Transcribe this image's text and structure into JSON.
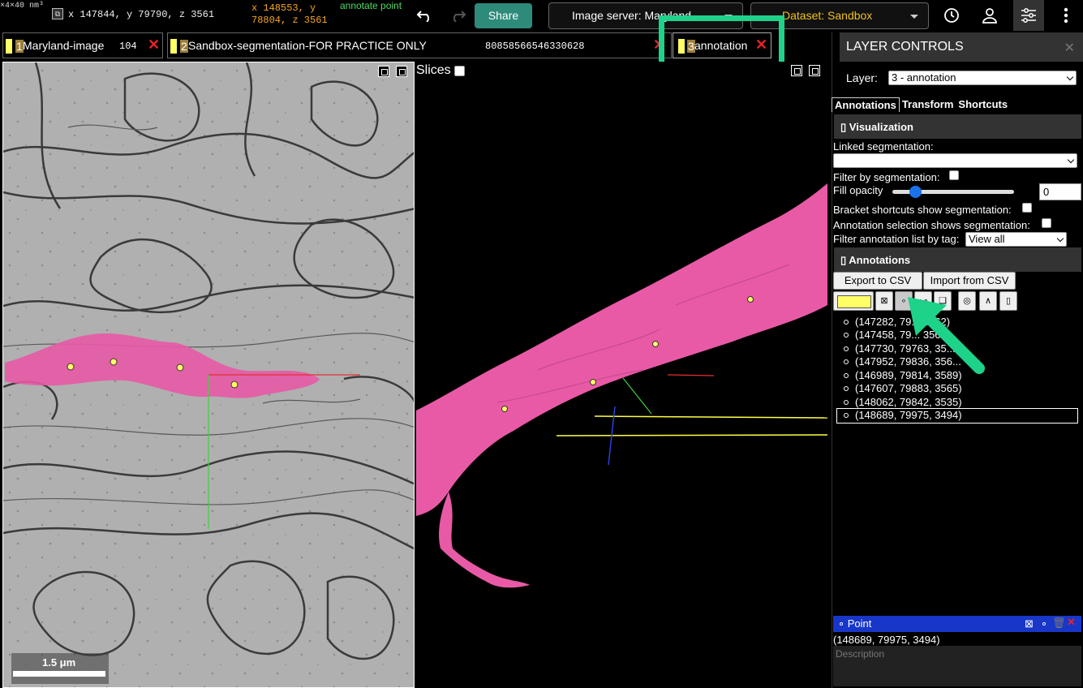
{
  "topbar": {
    "voxel_size": "×4×40 nm³",
    "position": "x 147844, y 79790, z 3561",
    "mouse_position": "x 148553, y 78804, z 3561",
    "mode": "annotate point",
    "share_label": "Share",
    "image_server_label": "Image server: Maryland",
    "dataset_label": "Dataset: Sandbox",
    "icons": [
      "undo-icon",
      "redo-icon",
      "history-icon",
      "user-icon",
      "settings-sliders-icon",
      "more-vert-icon"
    ]
  },
  "layers": [
    {
      "index": "1",
      "name": "Maryland-image",
      "value": "104"
    },
    {
      "index": "2",
      "name": "Sandbox-segmentation-FOR PRACTICE ONLY",
      "value": "80858566546330628"
    },
    {
      "index": "3",
      "name": "annotation",
      "value": ""
    }
  ],
  "viewer3d": {
    "slices_label": "Slices",
    "slices_checked": false
  },
  "scalebar": {
    "label": "1.5 μm"
  },
  "side_panel": {
    "title": "LAYER CONTROLS",
    "layer_label": "Layer:",
    "layer_value": "3 - annotation",
    "tabs": [
      "Annotations",
      "Transform",
      "Shortcuts"
    ],
    "visualization": {
      "header": "Visualization",
      "linked_seg_label": "Linked segmentation:",
      "linked_seg_value": "",
      "filter_by_seg_label": "Filter by segmentation:",
      "fill_opacity_label": "Fill opacity",
      "fill_opacity_value": "0",
      "bracket_label": "Bracket shortcuts show segmentation:",
      "selection_label": "Annotation selection shows segmentation:",
      "filter_tag_label": "Filter annotation list by tag:",
      "filter_tag_value": "View all"
    },
    "annotations": {
      "header": "Annotations",
      "export_label": "Export to CSV",
      "import_label": "Import from CSV",
      "tool_color": "#ffff66",
      "items": [
        "(147282, 79... 3562)",
        "(147458, 79... 3562)",
        "(147730, 79763, 35...",
        "(147952, 79836, 356...",
        "(146989, 79814, 3589)",
        "(147607, 79883, 3565)",
        "(148062, 79842, 3535)",
        "(148689, 79975, 3494)"
      ],
      "selected_index": 7
    },
    "point": {
      "type_label": "Point",
      "coords": "(148689, 79975, 3494)",
      "description_placeholder": "Description"
    }
  },
  "colors": {
    "segment": "#e85aa6",
    "annotation": "#ffff66",
    "highlight": "#1ed28a",
    "accent_blue": "#1836c8",
    "share": "#2e8b7a"
  }
}
